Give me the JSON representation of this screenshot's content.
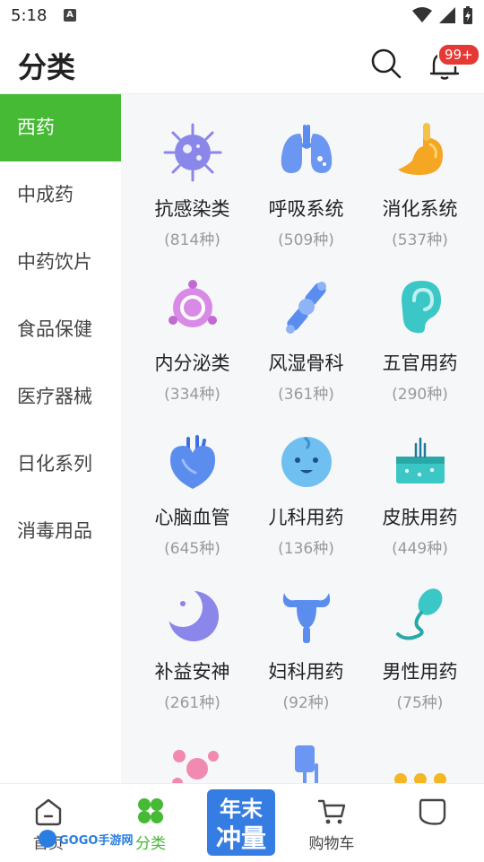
{
  "status": {
    "time": "5:18",
    "notif_letter": "A"
  },
  "header": {
    "title": "分类",
    "badge": "99+"
  },
  "sidebar": {
    "items": [
      {
        "label": "西药",
        "active": true
      },
      {
        "label": "中成药"
      },
      {
        "label": "中药饮片"
      },
      {
        "label": "食品保健"
      },
      {
        "label": "医疗器械"
      },
      {
        "label": "日化系列"
      },
      {
        "label": "消毒用品"
      }
    ]
  },
  "categories": [
    {
      "name": "抗感染类",
      "count": "(814种)",
      "icon": "virus-icon"
    },
    {
      "name": "呼吸系统",
      "count": "(509种)",
      "icon": "lungs-icon"
    },
    {
      "name": "消化系统",
      "count": "(537种)",
      "icon": "stomach-icon"
    },
    {
      "name": "内分泌类",
      "count": "(334种)",
      "icon": "gland-icon"
    },
    {
      "name": "风湿骨科",
      "count": "(361种)",
      "icon": "bone-icon"
    },
    {
      "name": "五官用药",
      "count": "(290种)",
      "icon": "ear-icon"
    },
    {
      "name": "心脑血管",
      "count": "(645种)",
      "icon": "heart-icon"
    },
    {
      "name": "儿科用药",
      "count": "(136种)",
      "icon": "baby-icon"
    },
    {
      "name": "皮肤用药",
      "count": "(449种)",
      "icon": "skin-icon"
    },
    {
      "name": "补益安神",
      "count": "(261种)",
      "icon": "moon-icon"
    },
    {
      "name": "妇科用药",
      "count": "(92种)",
      "icon": "uterus-icon"
    },
    {
      "name": "男性用药",
      "count": "(75种)",
      "icon": "sperm-icon"
    }
  ],
  "tabbar": {
    "home": "首页",
    "category": "分类",
    "cart": "购物车",
    "mine": "",
    "promo_line1": "年末",
    "promo_line2": "冲量"
  },
  "watermark": "GOGO手游网",
  "colors": {
    "accent": "#46b935",
    "badge": "#e53935",
    "icon_blue": "#6b8cf0",
    "icon_orange": "#f5a623"
  }
}
